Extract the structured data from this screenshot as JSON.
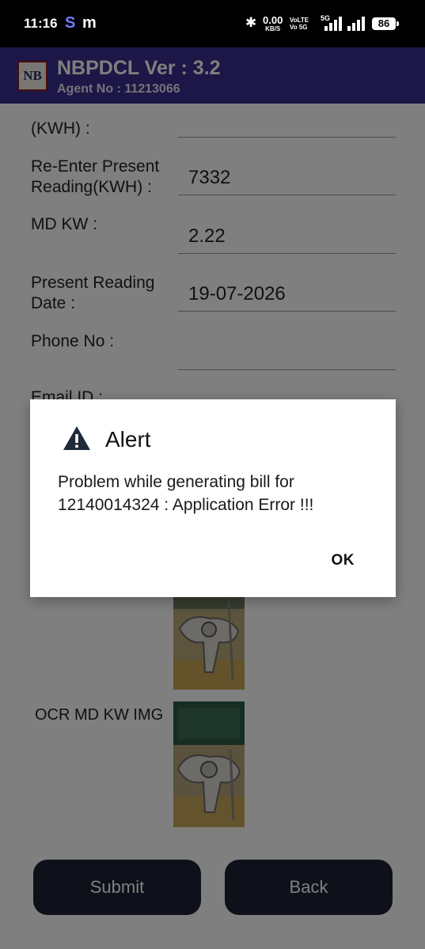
{
  "status_bar": {
    "time": "11:16",
    "app_icon_1": "S",
    "app_icon_2": "m",
    "net_speed": "0.00",
    "net_unit": "KB/S",
    "volte_1": "VoLTE",
    "volte_2": "Vo 5G",
    "network_5g": "5G",
    "battery": "86"
  },
  "app_bar": {
    "logo_text": "NB",
    "title": "NBPDCL Ver : 3.2",
    "agent": "Agent No : 11213066"
  },
  "form": {
    "kwh_label": "(KWH) :",
    "kwh_value": "",
    "reenter_label_1": "Re-Enter Present",
    "reenter_label_2": "Reading(KWH) :",
    "reenter_value": "7332",
    "md_label": "MD KW :",
    "md_value": "2.22",
    "date_label_1": "Present Reading",
    "date_label_2": "Date :",
    "date_value": "19-07-2026",
    "phone_label": "Phone No  :",
    "phone_value": "",
    "email_label": "Email ID  :"
  },
  "ocr": {
    "md_kw_img_label": "OCR MD KW IMG"
  },
  "buttons": {
    "submit": "Submit",
    "back": "Back"
  },
  "dialog": {
    "icon": "warning-icon",
    "title": "Alert",
    "message": "Problem while generating bill for 12140014324 : Application Error !!!",
    "ok": "OK"
  },
  "colors": {
    "app_bar": "#3b2e8f",
    "button": "#1d2333",
    "scrim": "rgba(0,0,0,0.5)"
  }
}
